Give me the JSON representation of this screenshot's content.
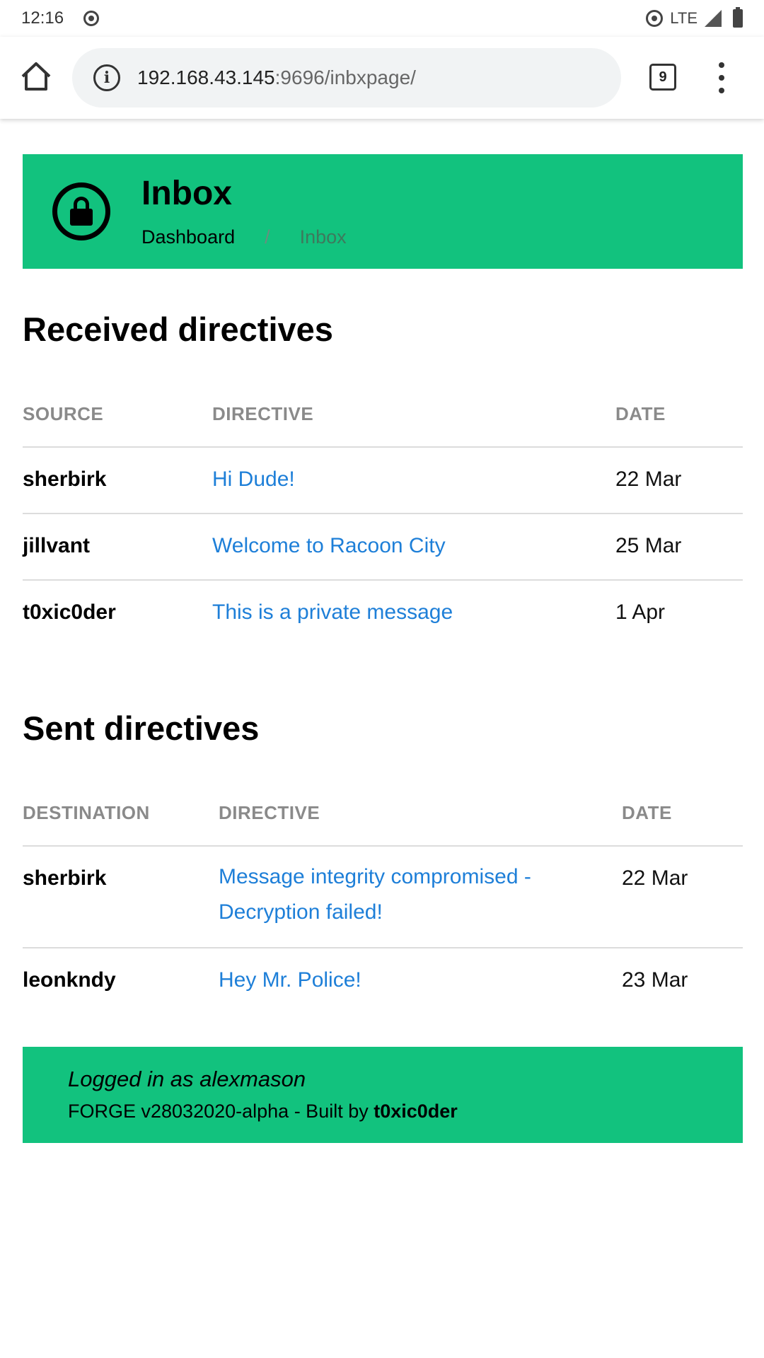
{
  "statusbar": {
    "time": "12:16",
    "network": "LTE"
  },
  "browser": {
    "url_host": "192.168.43.145",
    "url_rest": ":9696/inbxpage/",
    "tab_count": "9"
  },
  "header": {
    "title": "Inbox",
    "breadcrumb": {
      "home": "Dashboard",
      "separator": "/",
      "current": "Inbox"
    },
    "accent_color": "#12c27e"
  },
  "received": {
    "title": "Received directives",
    "columns": [
      "SOURCE",
      "DIRECTIVE",
      "DATE"
    ],
    "rows": [
      {
        "source": "sherbirk",
        "directive": "Hi Dude!",
        "date": "22 Mar"
      },
      {
        "source": "jillvant",
        "directive": "Welcome to Racoon City",
        "date": "25 Mar"
      },
      {
        "source": "t0xic0der",
        "directive": "This is a private message",
        "date": "1 Apr"
      }
    ]
  },
  "sent": {
    "title": "Sent directives",
    "columns": [
      "DESTINATION",
      "DIRECTIVE",
      "DATE"
    ],
    "rows": [
      {
        "destination": "sherbirk",
        "directive": "Message integrity compromised - Decryption failed!",
        "date": "22 Mar"
      },
      {
        "destination": "leonkndy",
        "directive": "Hey Mr. Police!",
        "date": "23 Mar"
      }
    ]
  },
  "footer": {
    "logged_in": "Logged in as alexmason",
    "built_prefix": "FORGE v28032020-alpha - Built by ",
    "author": "t0xic0der"
  },
  "link_color": "#1e7fd8"
}
